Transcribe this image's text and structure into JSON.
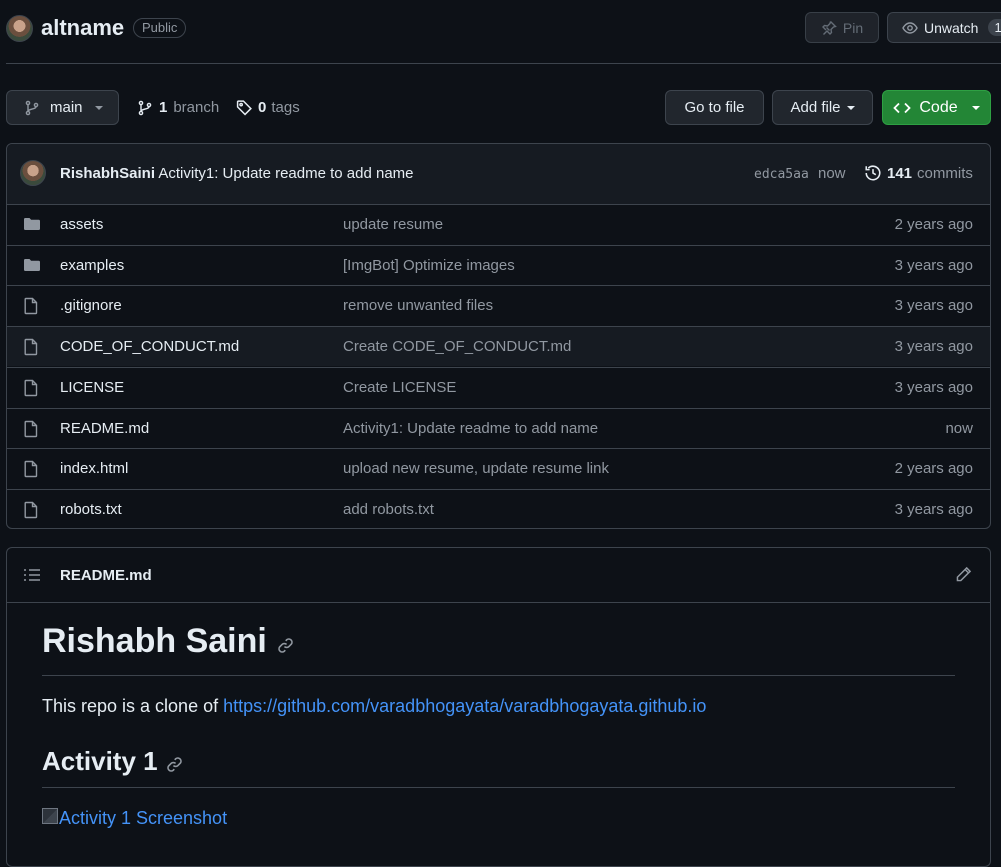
{
  "repo": {
    "name": "altname",
    "visibility": "Public",
    "pin_label": "Pin",
    "unwatch_label": "Unwatch",
    "watch_count": "1"
  },
  "branchbar": {
    "branch": "main",
    "branch_count": "1",
    "branch_label": "branch",
    "tag_count": "0",
    "tag_label": "tags",
    "go_to_file": "Go to file",
    "add_file": "Add file",
    "code": "Code"
  },
  "commit": {
    "author": "RishabhSaini",
    "message": "Activity1: Update readme to add name",
    "sha": "edca5aa",
    "time": "now",
    "count": "141",
    "count_label": "commits"
  },
  "files": [
    {
      "type": "folder",
      "name": "assets",
      "message": "update resume",
      "age": "2 years ago"
    },
    {
      "type": "folder",
      "name": "examples",
      "message": "[ImgBot] Optimize images",
      "age": "3 years ago"
    },
    {
      "type": "file",
      "name": ".gitignore",
      "message": "remove unwanted files",
      "age": "3 years ago"
    },
    {
      "type": "file",
      "name": "CODE_OF_CONDUCT.md",
      "message": "Create CODE_OF_CONDUCT.md",
      "age": "3 years ago"
    },
    {
      "type": "file",
      "name": "LICENSE",
      "message": "Create LICENSE",
      "age": "3 years ago"
    },
    {
      "type": "file",
      "name": "README.md",
      "message": "Activity1: Update readme to add name",
      "age": "now"
    },
    {
      "type": "file",
      "name": "index.html",
      "message": "upload new resume, update resume link",
      "age": "2 years ago"
    },
    {
      "type": "file",
      "name": "robots.txt",
      "message": "add robots.txt",
      "age": "3 years ago"
    }
  ],
  "readme": {
    "filename": "README.md",
    "h1": "Rishabh Saini",
    "intro": "This repo is a clone of ",
    "intro_link": "https://github.com/varadbhogayata/varadbhogayata.github.io",
    "h2": "Activity 1",
    "image_alt": "Activity 1 Screenshot"
  },
  "colors": {
    "background": "#0d1117",
    "border": "#3d444d",
    "button": "#21262d",
    "primary_button": "#238636",
    "link": "#4493f8",
    "muted": "#9198a1"
  }
}
